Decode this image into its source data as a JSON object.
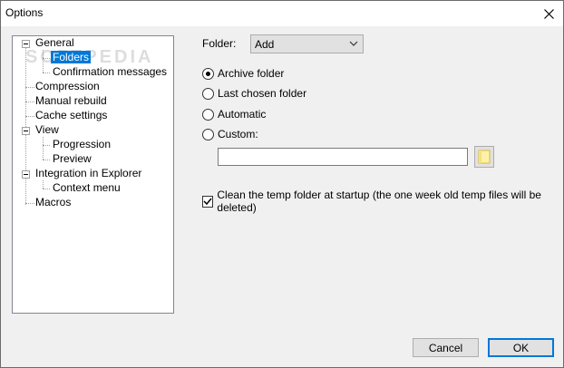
{
  "window": {
    "title": "Options"
  },
  "watermark": "SOFTPEDIA",
  "tree": {
    "general": "General",
    "folders": "Folders",
    "confirmation": "Confirmation messages",
    "compression": "Compression",
    "manual_rebuild": "Manual rebuild",
    "cache": "Cache settings",
    "view": "View",
    "progression": "Progression",
    "preview": "Preview",
    "integration": "Integration in Explorer",
    "context_menu": "Context menu",
    "macros": "Macros"
  },
  "folder": {
    "label": "Folder:",
    "selected": "Add"
  },
  "options": {
    "archive_folder": "Archive folder",
    "last_chosen": "Last chosen folder",
    "automatic": "Automatic",
    "custom": "Custom:",
    "custom_path": "",
    "selected": "archive_folder"
  },
  "clean_temp": {
    "label": "Clean the temp folder at startup (the one week old temp files will be deleted)",
    "checked": true
  },
  "buttons": {
    "cancel": "Cancel",
    "ok": "OK"
  }
}
